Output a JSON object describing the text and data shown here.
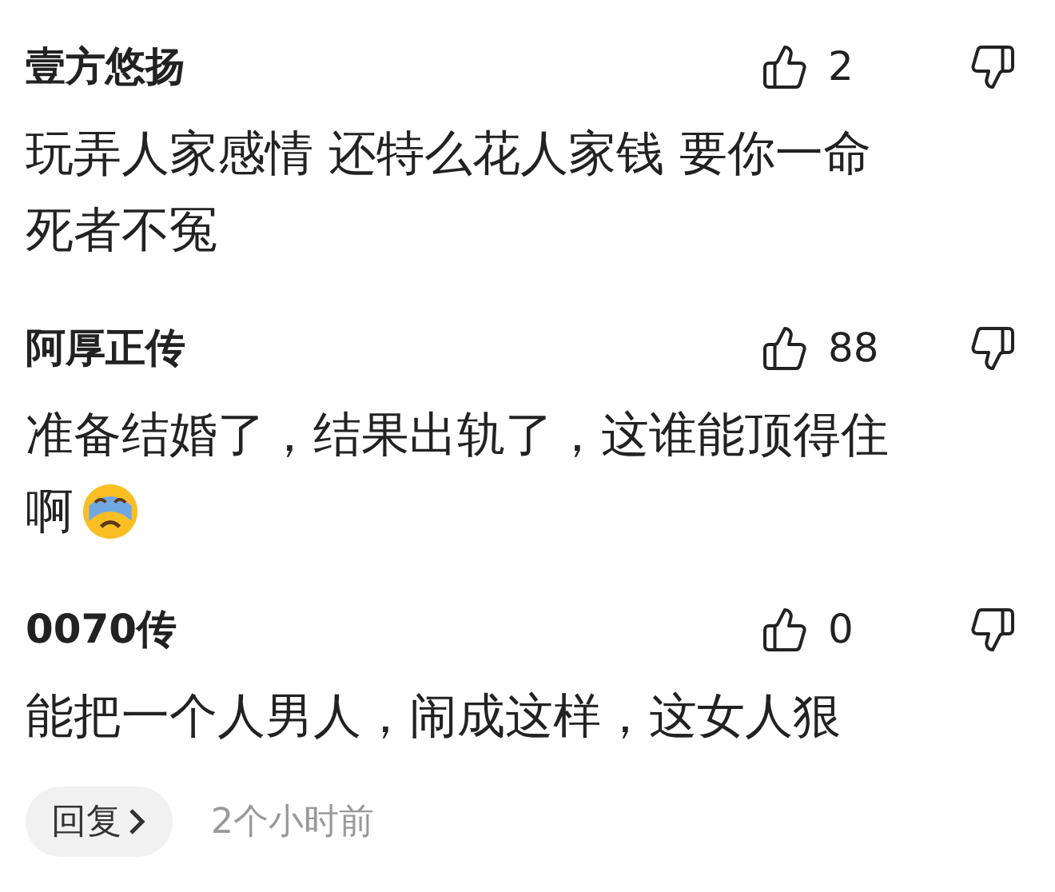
{
  "comments": [
    {
      "author": "壹方悠扬",
      "likes": "2",
      "lines": [
        "玩弄人家感情 还特么花人家钱 要你一命",
        "死者不冤"
      ],
      "crying_emoji": false
    },
    {
      "author": "阿厚正传",
      "likes": "88",
      "lines": [
        "准备结婚了，结果出轨了，这谁能顶得住",
        "啊"
      ],
      "crying_emoji": true
    },
    {
      "author": "0070传",
      "likes": "0",
      "lines": [
        "能把一个人男人，闹成这样，这女人狠"
      ],
      "crying_emoji": false
    }
  ],
  "footer": {
    "reply_button": "回复",
    "time": "2个小时前"
  }
}
